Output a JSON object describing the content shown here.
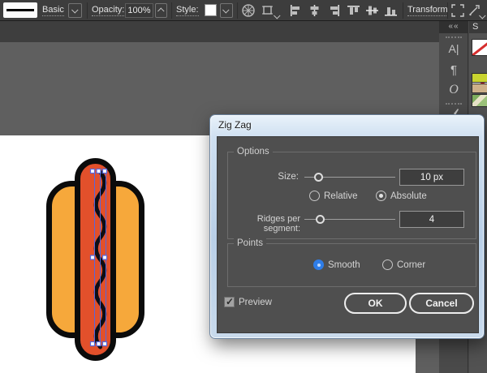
{
  "colors": {
    "toolbar-bg": "#3d3d3d",
    "strip-bg": "#3e3e3e",
    "pasteboard": "#5f5f5f",
    "artboard": "#ffffff",
    "dock-column-bg": "#4a4a4a",
    "dock-panel-bg": "#525252",
    "dialog-client": "#4f4f4f",
    "accent-blue": "#2e7de8",
    "bun-orange": "#f6a83b",
    "sausage-red": "#e2502b",
    "selection-blue": "#5468e0",
    "swatch-yellow-green": "#c9d42f",
    "swatch-tan": "#cdb089"
  },
  "toolbar": {
    "brush_label": "Basic",
    "opacity_label": "Opacity:",
    "opacity_value": "100%",
    "style_label": "Style:",
    "transform_label": "Transform"
  },
  "dock": {
    "collapse_glyph": "««",
    "panel_title": "S",
    "char_icon": "A|",
    "paragraph_icon": "¶",
    "opentype_icon": "O"
  },
  "dialog": {
    "title": "Zig Zag",
    "options_legend": "Options",
    "size_label": "Size:",
    "size_value": "10 px",
    "relative_label": "Relative",
    "absolute_label": "Absolute",
    "ridges_label": "Ridges per segment:",
    "ridges_value": "4",
    "points_legend": "Points",
    "smooth_label": "Smooth",
    "corner_label": "Corner",
    "preview_label": "Preview",
    "ok_label": "OK",
    "cancel_label": "Cancel"
  }
}
